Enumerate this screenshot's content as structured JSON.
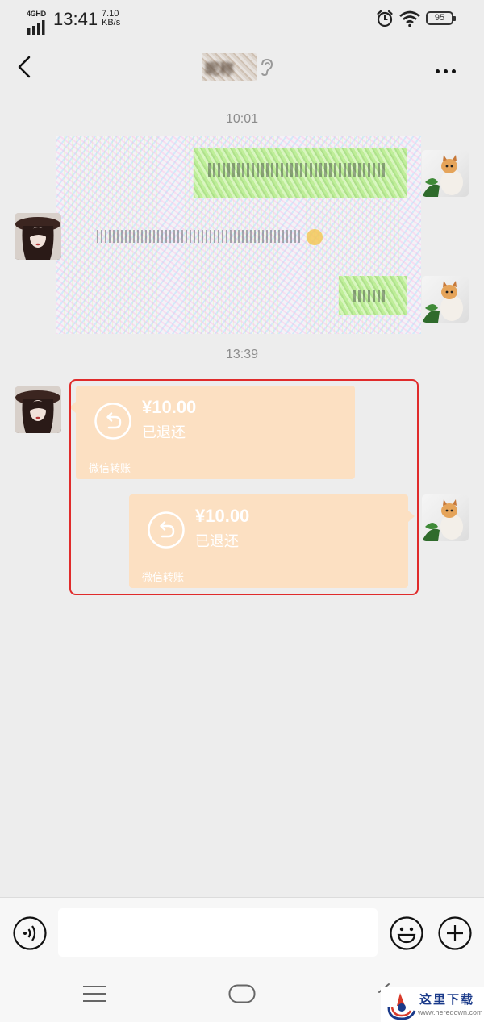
{
  "status_bar": {
    "network": "4GHD",
    "time": "13:41",
    "speed_value": "7.10",
    "speed_unit": "KB/s",
    "battery": "95",
    "icons": [
      "signal-icon",
      "alarm-icon",
      "wifi-icon",
      "battery-icon"
    ]
  },
  "header": {
    "title": "昵称",
    "back_icon": "chevron-left-icon",
    "listen_icon": "ear-icon",
    "more_icon": "more-dots-icon"
  },
  "messages": {
    "timestamp_1": "10:01",
    "timestamp_2": "13:39",
    "transfer_1": {
      "amount": "¥10.00",
      "status": "已退还",
      "footer": "微信转账",
      "direction": "received"
    },
    "transfer_2": {
      "amount": "¥10.00",
      "status": "已退还",
      "footer": "微信转账",
      "direction": "sent"
    }
  },
  "input_bar": {
    "voice_icon": "voice-icon",
    "emoji_icon": "emoji-icon",
    "plus_icon": "plus-icon"
  },
  "nav_bar": {
    "icons": [
      "menu-icon",
      "home-icon",
      "back-icon"
    ]
  },
  "watermark": {
    "text": "这里下载",
    "url": "www.heredown.com"
  },
  "colors": {
    "background": "#ededed",
    "transfer_bubble": "#fce0c2",
    "highlight": "#e02b2b"
  }
}
